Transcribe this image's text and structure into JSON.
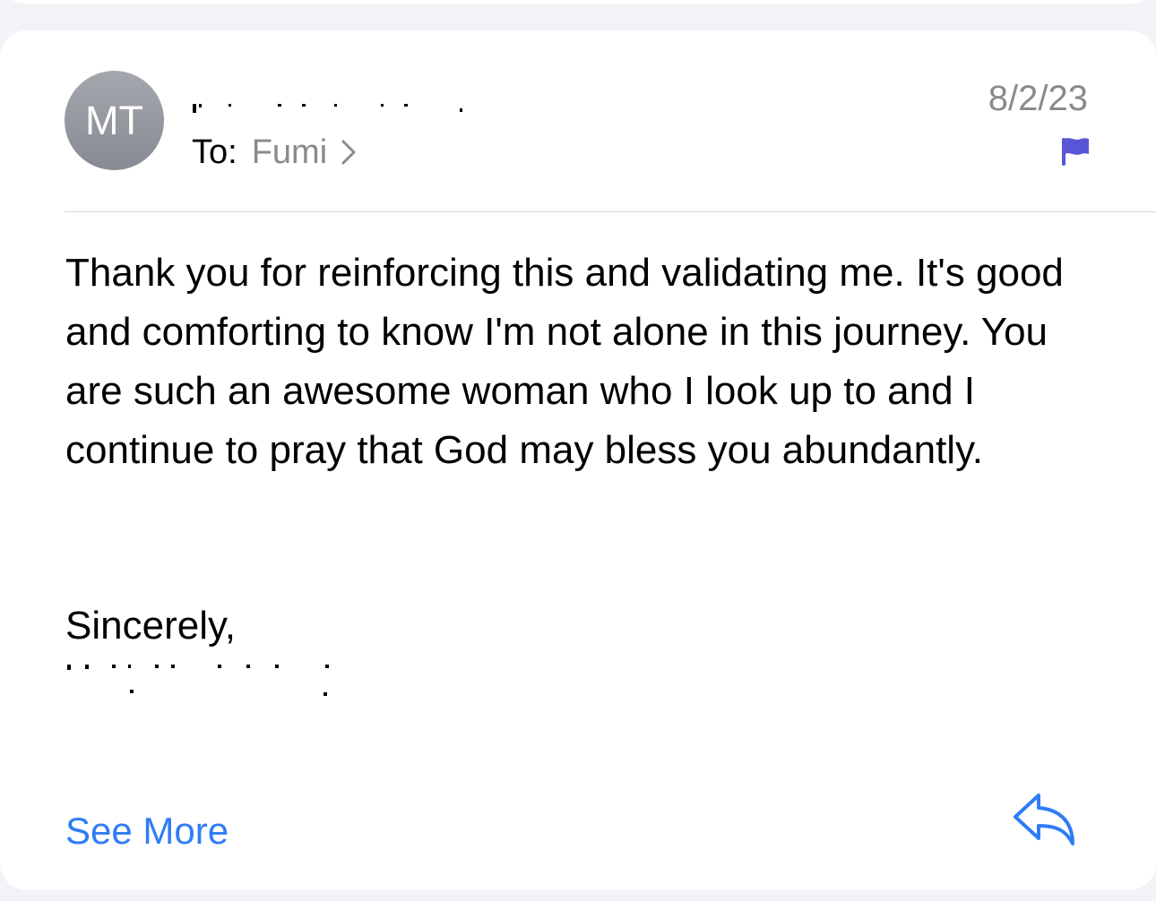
{
  "message": {
    "sender_initials": "MT",
    "to_label": "To:",
    "recipient": "Fumi",
    "date": "8/2/23",
    "body": "Thank you for reinforcing this and validating me. It's good and comforting to know I'm not alone in this journey. You are such an awesome woman who I look up to and I continue to pray that God may bless you abundantly.",
    "signoff": "Sincerely,"
  },
  "actions": {
    "see_more_label": "See More"
  },
  "colors": {
    "accent": "#2f7cf6",
    "flag": "#5856d6",
    "secondary_text": "#8a8a8e",
    "avatar": "#8d9098"
  },
  "icons": {
    "recipient_chevron": "chevron-right-icon",
    "flag": "flag-icon",
    "reply": "reply-icon"
  }
}
